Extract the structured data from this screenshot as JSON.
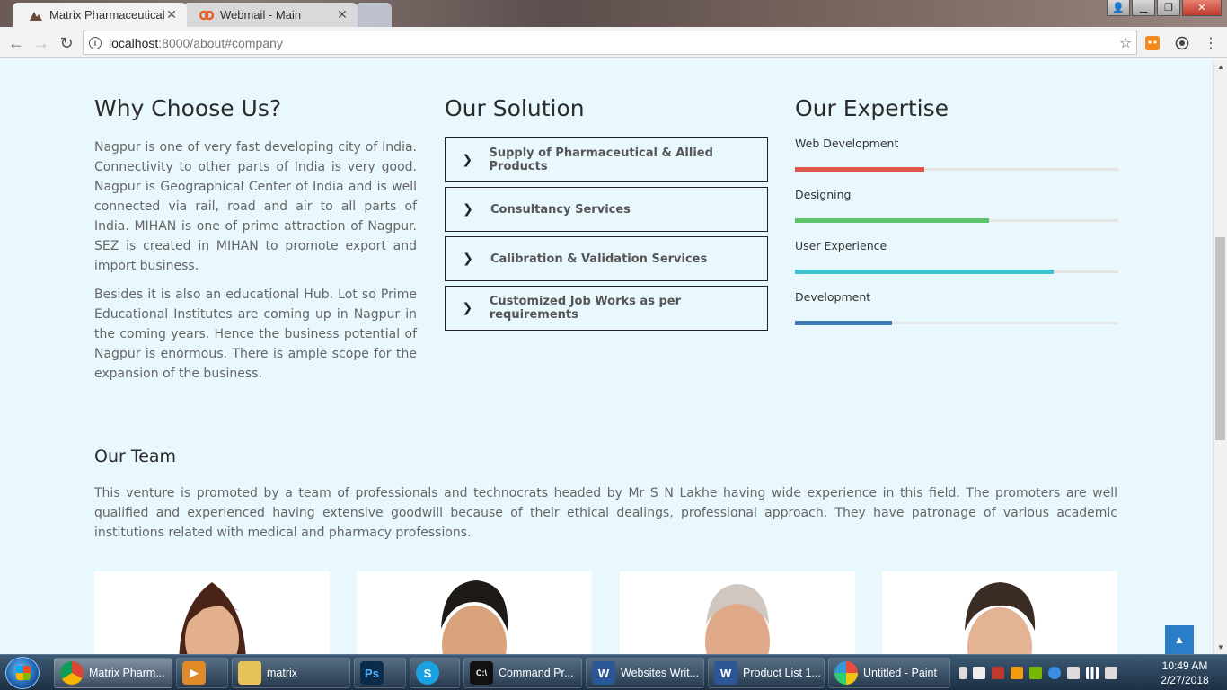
{
  "browser": {
    "tabs": [
      {
        "title": "Matrix Pharmaceuticals, I",
        "active": true
      },
      {
        "title": "Webmail - Main",
        "active": false
      }
    ],
    "url_host": "localhost",
    "url_path": ":8000/about#company"
  },
  "why_choose": {
    "heading": "Why Choose Us?",
    "paragraphs": [
      "Nagpur is one of very fast developing city of India. Connectivity to other parts of India is very good. Nagpur is Geographical Center of India and is well connected via rail, road and air to all parts of India. MIHAN is one of prime attraction of Nagpur. SEZ is created in MIHAN to promote export and import business.",
      "Besides it is also an educational Hub. Lot so Prime Educational Institutes are coming up in Nagpur in the coming years. Hence the business potential of Nagpur is enormous. There is ample scope for the expansion of the business."
    ]
  },
  "solution": {
    "heading": "Our Solution",
    "items": [
      "Supply of Pharmaceutical & Allied Products",
      "Consultancy Services",
      "Calibration & Validation Services",
      "Customized Job Works as per requirements"
    ]
  },
  "expertise": {
    "heading": "Our Expertise",
    "skills": [
      {
        "label": "Web Development",
        "percent": 40,
        "color": "#e2554b"
      },
      {
        "label": "Designing",
        "percent": 60,
        "color": "#5cc46a"
      },
      {
        "label": "User Experience",
        "percent": 80,
        "color": "#3dc2cf"
      },
      {
        "label": "Development",
        "percent": 30,
        "color": "#3d7ab8"
      }
    ]
  },
  "team": {
    "heading": "Our Team",
    "text": "This venture is promoted by a team of professionals and technocrats headed by Mr S N Lakhe having wide experience in this field. The promoters are well qualified and experienced having extensive goodwill because of their ethical dealings, professional approach. They have patronage of various academic institutions related with medical and pharmacy professions."
  },
  "taskbar": {
    "items": [
      {
        "label": "Matrix Pharm...",
        "icon": "chrome-icon"
      },
      {
        "label": "",
        "icon": "media-player-icon"
      },
      {
        "label": "matrix",
        "icon": "folder-icon"
      },
      {
        "label": "",
        "icon": "photoshop-icon"
      },
      {
        "label": "",
        "icon": "skype-icon"
      },
      {
        "label": "Command Pr...",
        "icon": "cmd-icon"
      },
      {
        "label": "Websites Writ...",
        "icon": "word-icon"
      },
      {
        "label": "Product List 1...",
        "icon": "word-icon"
      },
      {
        "label": "Untitled - Paint",
        "icon": "paint-icon"
      }
    ],
    "time": "10:49 AM",
    "date": "2/27/2018"
  }
}
